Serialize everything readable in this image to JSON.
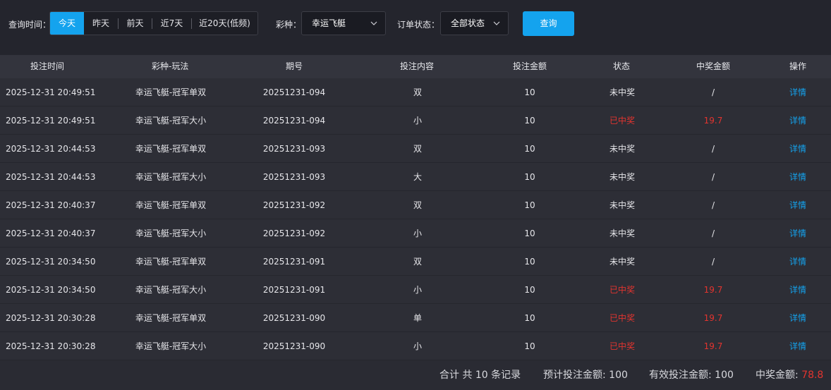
{
  "filters": {
    "time_label": "查询时间：",
    "time_options": [
      "今天",
      "昨天",
      "前天",
      "近7天",
      "近20天(低频)"
    ],
    "lottery_label": "彩种：",
    "lottery_value": "幸运飞艇",
    "status_label": "订单状态：",
    "status_value": "全部状态",
    "query_label": "查询"
  },
  "table": {
    "headers": [
      "投注时间",
      "彩种-玩法",
      "期号",
      "投注内容",
      "投注金额",
      "状态",
      "中奖金额",
      "操作"
    ],
    "action_label": "详情",
    "rows": [
      {
        "time": "2025-12-31 20:49:51",
        "game": "幸运飞艇-冠军单双",
        "issue": "20251231-094",
        "content": "双",
        "amount": "10",
        "status": "未中奖",
        "won": false,
        "prize": "/"
      },
      {
        "time": "2025-12-31 20:49:51",
        "game": "幸运飞艇-冠军大小",
        "issue": "20251231-094",
        "content": "小",
        "amount": "10",
        "status": "已中奖",
        "won": true,
        "prize": "19.7"
      },
      {
        "time": "2025-12-31 20:44:53",
        "game": "幸运飞艇-冠军单双",
        "issue": "20251231-093",
        "content": "双",
        "amount": "10",
        "status": "未中奖",
        "won": false,
        "prize": "/"
      },
      {
        "time": "2025-12-31 20:44:53",
        "game": "幸运飞艇-冠军大小",
        "issue": "20251231-093",
        "content": "大",
        "amount": "10",
        "status": "未中奖",
        "won": false,
        "prize": "/"
      },
      {
        "time": "2025-12-31 20:40:37",
        "game": "幸运飞艇-冠军单双",
        "issue": "20251231-092",
        "content": "双",
        "amount": "10",
        "status": "未中奖",
        "won": false,
        "prize": "/"
      },
      {
        "time": "2025-12-31 20:40:37",
        "game": "幸运飞艇-冠军大小",
        "issue": "20251231-092",
        "content": "小",
        "amount": "10",
        "status": "未中奖",
        "won": false,
        "prize": "/"
      },
      {
        "time": "2025-12-31 20:34:50",
        "game": "幸运飞艇-冠军单双",
        "issue": "20251231-091",
        "content": "双",
        "amount": "10",
        "status": "未中奖",
        "won": false,
        "prize": "/"
      },
      {
        "time": "2025-12-31 20:34:50",
        "game": "幸运飞艇-冠军大小",
        "issue": "20251231-091",
        "content": "小",
        "amount": "10",
        "status": "已中奖",
        "won": true,
        "prize": "19.7"
      },
      {
        "time": "2025-12-31 20:30:28",
        "game": "幸运飞艇-冠军单双",
        "issue": "20251231-090",
        "content": "单",
        "amount": "10",
        "status": "已中奖",
        "won": true,
        "prize": "19.7"
      },
      {
        "time": "2025-12-31 20:30:28",
        "game": "幸运飞艇-冠军大小",
        "issue": "20251231-090",
        "content": "小",
        "amount": "10",
        "status": "已中奖",
        "won": true,
        "prize": "19.7"
      }
    ]
  },
  "footer": {
    "total_records": "合计 共 10 条记录",
    "expected_bet_label": "预计投注金额: ",
    "expected_bet_value": "100",
    "valid_bet_label": "有效投注金额: ",
    "valid_bet_value": "100",
    "prize_label": "中奖金额: ",
    "prize_value": "78.8"
  },
  "colors": {
    "accent": "#14a3ee",
    "win": "#e3342f",
    "background": "#2a2b33"
  },
  "icons": {
    "dropdown": "chevron-down-icon"
  }
}
